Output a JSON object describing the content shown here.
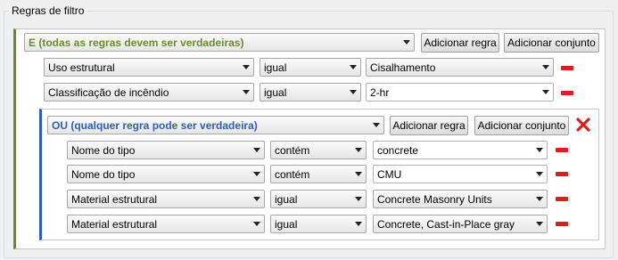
{
  "groupbox": {
    "title": "Regras de filtro"
  },
  "and_set": {
    "label": "E (todas as regras devem ser verdadeiras)",
    "add_rule_label": "Adicionar regra",
    "add_set_label": "Adicionar conjunto",
    "rules": [
      {
        "parameter": "Uso estrutural",
        "operator": "igual",
        "value": "Cisalhamento"
      },
      {
        "parameter": "Classificação de incêndio",
        "operator": "igual",
        "value": "2-hr"
      }
    ]
  },
  "or_set": {
    "label": "OU (qualquer regra pode ser verdadeira)",
    "add_rule_label": "Adicionar regra",
    "add_set_label": "Adicionar conjunto",
    "rules": [
      {
        "parameter": "Nome do tipo",
        "operator": "contém",
        "value": "concrete"
      },
      {
        "parameter": "Nome do tipo",
        "operator": "contém",
        "value": "CMU"
      },
      {
        "parameter": "Material estrutural",
        "operator": "igual",
        "value": "Concrete Masonry Units"
      },
      {
        "parameter": "Material estrutural",
        "operator": "igual",
        "value": "Concrete, Cast-in-Place gray"
      }
    ]
  },
  "colors": {
    "and_accent": "#6c8c2c",
    "or_accent": "#2f5fb0",
    "remove": "#d82020"
  },
  "icons": {
    "remove_rule": "minus-icon",
    "delete_set": "close-x-icon",
    "dropdown": "chevron-down-icon"
  }
}
